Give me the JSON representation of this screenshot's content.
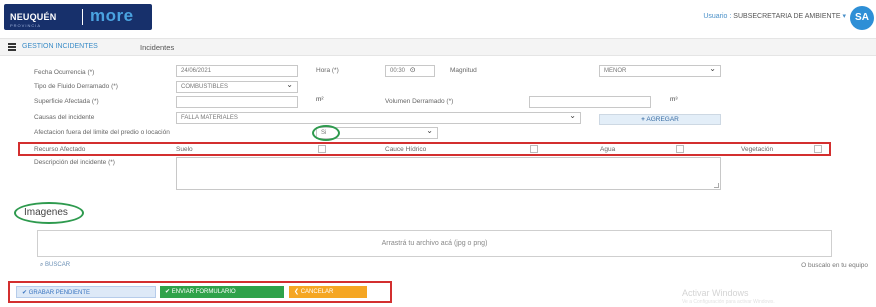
{
  "header": {
    "logo_text": "NEUQUÉN",
    "logo_brand": "more",
    "logo_tagline": "PROVINCIA",
    "user_label": "Usuario :",
    "user_name": "SUBSECRETARIA DE AMBIENTE",
    "avatar_initials": "SA"
  },
  "nav": {
    "crumb_module": "GESTION INCIDENTES",
    "crumb_page": "Incidentes"
  },
  "form": {
    "fecha_label": "Fecha Ocurrencia (*)",
    "fecha_value": "24/06/2021",
    "hora_label": "Hora (*)",
    "hora_value": "00:30",
    "magnitud_label": "Magnitud",
    "magnitud_value": "MENOR",
    "tipo_label": "Tipo de Fluido Derramado (*)",
    "tipo_value": "COMBUSTIBLES",
    "superficie_label": "Superficie Afectada (*)",
    "superficie_unit": "m²",
    "volumen_label": "Volumen Derramado (*)",
    "volumen_unit": "m³",
    "causas_label": "Causas del incidente",
    "causas_value": "FALLA MATERIALES",
    "agregar_label": "AGREGAR",
    "fuera_label": "Afectacion fuera del limite del predio o locación",
    "fuera_value": "Si",
    "recurso_label": "Recurso Afectado",
    "recursos": [
      {
        "label": "Suelo",
        "checked": false
      },
      {
        "label": "Cauce Hídrico",
        "checked": false
      },
      {
        "label": "Agua",
        "checked": false
      },
      {
        "label": "Vegetación",
        "checked": false
      }
    ],
    "descripcion_label": "Descripción del incidente (*)"
  },
  "images": {
    "title": "Imagenes",
    "dropzone_text": "Arrastrá tu archivo acá (jpg o png)",
    "search_label": "BUSCAR",
    "drop_hint": "O buscalo en tu equipo"
  },
  "actions": {
    "pending_label": "GRABAR PENDIENTE",
    "send_label": "ENVIAR FORMULARIO",
    "cancel_label": "CANCELAR"
  },
  "watermark": {
    "title": "Activar Windows",
    "subtitle": "Ve a Configuración para activar Windows."
  },
  "colors": {
    "header_blue": "#17306b",
    "brand_blue": "#4aa3e0",
    "success_green": "#2fa24a",
    "warning_orange": "#f5a623",
    "highlight_red": "#d32f2f",
    "highlight_green": "#2e9a4e"
  }
}
